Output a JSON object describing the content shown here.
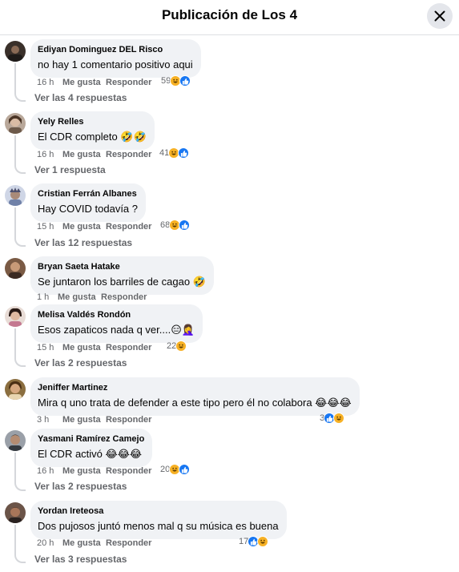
{
  "header": {
    "title": "Publicación de Los 4"
  },
  "comments": [
    {
      "author": "Ediyan Dominguez DEL Risco",
      "text": "no hay 1 comentario positivo aqui",
      "time": "16 h",
      "like": "Me gusta",
      "reply": "Responder",
      "count": "59",
      "reactions": [
        "haha",
        "like"
      ],
      "replies": "Ver las 4 respuestas"
    },
    {
      "author": "Yely Relles",
      "text": "El CDR completo 🤣🤣",
      "time": "16 h",
      "like": "Me gusta",
      "reply": "Responder",
      "count": "41",
      "reactions": [
        "haha",
        "like"
      ],
      "replies": "Ver 1 respuesta"
    },
    {
      "author": "Cristian Ferrán Albanes",
      "text": "Hay COVID todavía ?",
      "time": "15 h",
      "like": "Me gusta",
      "reply": "Responder",
      "count": "68",
      "reactions": [
        "haha",
        "like"
      ],
      "replies": "Ver las 12 respuestas"
    },
    {
      "author": "Bryan Saeta Hatake",
      "text": "Se juntaron los barriles de cagao 🤣",
      "time": "1 h",
      "like": "Me gusta",
      "reply": "Responder",
      "count": "",
      "reactions": [],
      "replies": ""
    },
    {
      "author": "Melisa Valdés Rondón",
      "text": "Esos zapaticos nada q ver....😑🤦‍♀️",
      "time": "15 h",
      "like": "Me gusta",
      "reply": "Responder",
      "count": "22",
      "reactions": [
        "haha"
      ],
      "replies": "Ver las 2 respuestas"
    },
    {
      "author": "Jeniffer Martinez",
      "text": "Mira q uno trata de defender a este tipo pero él no colabora 😂😂😂",
      "time": "3 h",
      "like": "Me gusta",
      "reply": "Responder",
      "count": "3",
      "reactions": [
        "like",
        "haha"
      ],
      "replies": ""
    },
    {
      "author": "Yasmani Ramírez Camejo",
      "text": "El CDR activó 😂😂😂",
      "time": "16 h",
      "like": "Me gusta",
      "reply": "Responder",
      "count": "20",
      "reactions": [
        "haha",
        "like"
      ],
      "replies": "Ver las 2 respuestas"
    },
    {
      "author": "Yordan Ireteosa",
      "text": "Dos pujosos juntó menos mal q su música es buena",
      "time": "20 h",
      "like": "Me gusta",
      "reply": "Responder",
      "count": "17",
      "reactions": [
        "like",
        "haha"
      ],
      "replies": "Ver las 3 respuestas"
    }
  ],
  "colors": {
    "like": "#1877f2",
    "haha": "#f7b125",
    "bubble": "#f0f2f5",
    "meta": "#65676b"
  },
  "icons": {
    "close": "close-icon",
    "like": "like-reaction-icon",
    "haha": "haha-reaction-icon"
  }
}
